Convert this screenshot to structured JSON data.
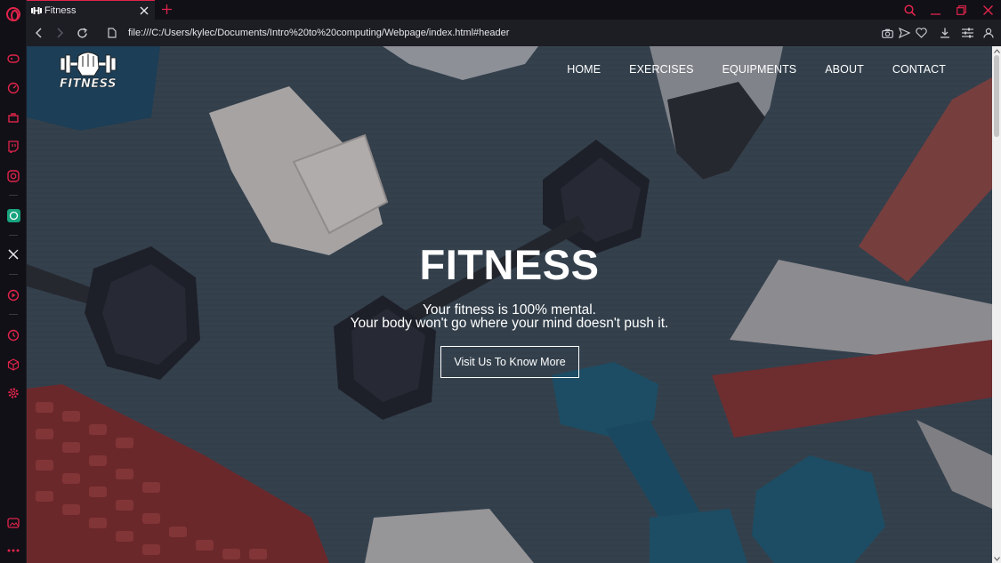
{
  "browser": {
    "tab": {
      "title": "Fitness",
      "favicon": "dumbbell-icon"
    },
    "address": {
      "url": "file:///C:/Users/kylec/Documents/Intro%20to%20computing/Webpage/index.html#header"
    },
    "sidebar_icons": [
      "opera-logo-icon",
      "gamepad-icon",
      "speed-dial-icon",
      "bag-icon",
      "twitch-icon",
      "instagram-icon",
      "chatgpt-icon",
      "x-twitter-icon",
      "player-icon",
      "history-icon",
      "cube-icon",
      "settings-icon",
      "gallery-icon",
      "more-icon"
    ],
    "accent": "#e0244b"
  },
  "site": {
    "logo_text": "FITNESS",
    "nav": [
      "HOME",
      "EXERCISES",
      "EQUIPMENTS",
      "ABOUT",
      "CONTACT"
    ],
    "hero": {
      "title": "FITNESS",
      "line1": "Your fitness is 100% mental.",
      "line2": "Your body won't go where your mind doesn't push it.",
      "button": "Visit Us To Know More"
    }
  }
}
